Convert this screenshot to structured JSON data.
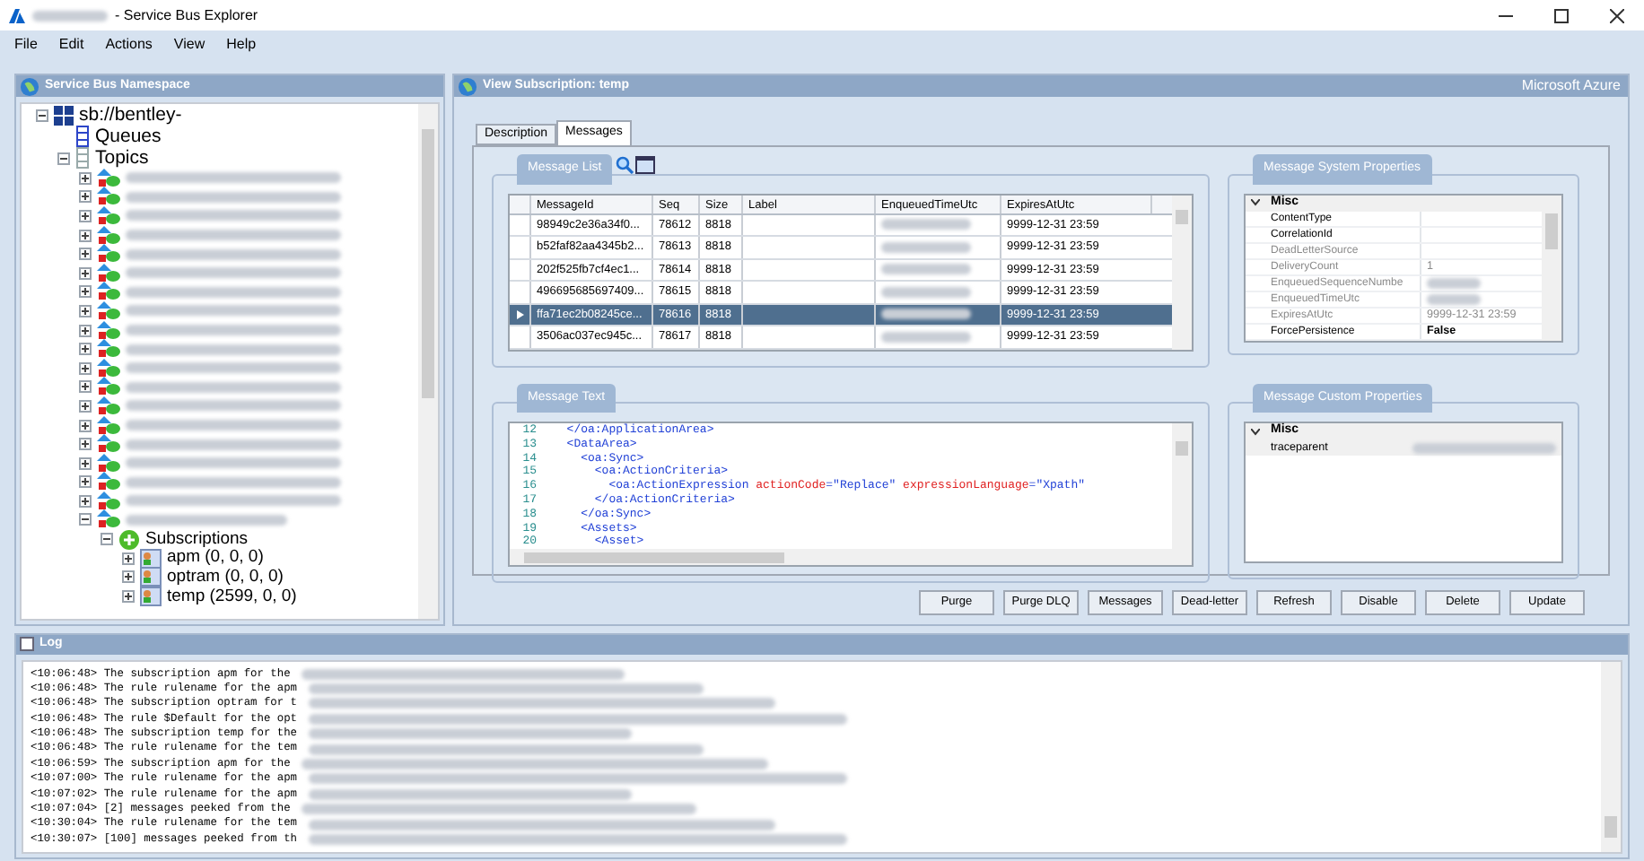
{
  "window": {
    "title": "- Service Bus Explorer",
    "brand": "Microsoft Azure"
  },
  "menu": [
    "File",
    "Edit",
    "Actions",
    "View",
    "Help"
  ],
  "namespace_panel": {
    "title": "Service Bus Namespace",
    "tree": {
      "label": "sb://bentley-",
      "expanded": true,
      "children": [
        {
          "label": "Queues",
          "kind": "queues"
        },
        {
          "label": "Topics",
          "kind": "topics",
          "expanded": true,
          "children": [
            {
              "kind": "topic",
              "expanded": false
            },
            {
              "kind": "topic",
              "expanded": false
            },
            {
              "kind": "topic",
              "expanded": false
            },
            {
              "kind": "topic",
              "expanded": false
            },
            {
              "kind": "topic",
              "expanded": false
            },
            {
              "kind": "topic",
              "expanded": false
            },
            {
              "kind": "topic",
              "expanded": false
            },
            {
              "kind": "topic",
              "expanded": false
            },
            {
              "kind": "topic",
              "expanded": false
            },
            {
              "kind": "topic",
              "expanded": false
            },
            {
              "kind": "topic",
              "expanded": false
            },
            {
              "kind": "topic",
              "expanded": false
            },
            {
              "kind": "topic",
              "expanded": false
            },
            {
              "kind": "topic",
              "expanded": false
            },
            {
              "kind": "topic",
              "expanded": false
            },
            {
              "kind": "topic",
              "expanded": false
            },
            {
              "kind": "topic",
              "expanded": false
            },
            {
              "kind": "topic",
              "expanded": false
            },
            {
              "kind": "topic",
              "expanded": true,
              "children": [
                {
                  "label": "Subscriptions",
                  "kind": "subscriptions",
                  "expanded": true,
                  "children": [
                    {
                      "label": "apm (0, 0, 0)",
                      "kind": "subscription",
                      "expanded": false
                    },
                    {
                      "label": "optram (0, 0, 0)",
                      "kind": "subscription",
                      "expanded": false
                    },
                    {
                      "label": "temp (2599, 0, 0)",
                      "kind": "subscription",
                      "expanded": false
                    }
                  ]
                }
              ]
            }
          ]
        }
      ]
    }
  },
  "view_panel": {
    "title": "View Subscription: temp",
    "tabs": [
      {
        "label": "Description",
        "selected": false
      },
      {
        "label": "Messages",
        "selected": true
      }
    ],
    "message_list": {
      "title": "Message List",
      "columns": [
        "MessageId",
        "Seq",
        "Size",
        "Label",
        "EnqueuedTimeUtc",
        "ExpiresAtUtc"
      ],
      "rows": [
        {
          "message_id": "98949c2e36a34f0...",
          "seq": "78612",
          "size": "8818",
          "expires": "9999-12-31 23:59",
          "selected": false
        },
        {
          "message_id": "b52faf82aa4345b2...",
          "seq": "78613",
          "size": "8818",
          "expires": "9999-12-31 23:59",
          "selected": false
        },
        {
          "message_id": "202f525fb7cf4ec1...",
          "seq": "78614",
          "size": "8818",
          "expires": "9999-12-31 23:59",
          "selected": false
        },
        {
          "message_id": "496695685697409...",
          "seq": "78615",
          "size": "8818",
          "expires": "9999-12-31 23:59",
          "selected": false
        },
        {
          "message_id": "ffa71ec2b08245ce...",
          "seq": "78616",
          "size": "8818",
          "expires": "9999-12-31 23:59",
          "selected": true
        },
        {
          "message_id": "3506ac037ec945c...",
          "seq": "78617",
          "size": "8818",
          "expires": "9999-12-31 23:59",
          "selected": false
        }
      ]
    },
    "system_properties": {
      "title": "Message System Properties",
      "category": "Misc",
      "rows": [
        {
          "name": "ContentType",
          "disabled": false
        },
        {
          "name": "CorrelationId",
          "disabled": false
        },
        {
          "name": "DeadLetterSource",
          "disabled": true
        },
        {
          "name": "DeliveryCount",
          "value": "1",
          "disabled": true
        },
        {
          "name": "EnqueuedSequenceNumbe",
          "disabled": true
        },
        {
          "name": "EnqueuedTimeUtc",
          "disabled": true
        },
        {
          "name": "ExpiresAtUtc",
          "value": "9999-12-31 23:59",
          "disabled": true
        },
        {
          "name": "ForcePersistence",
          "value": "False",
          "disabled": false,
          "modified": true
        }
      ]
    },
    "message_text": {
      "title": "Message Text",
      "lines": [
        {
          "number": "12",
          "tokens": [
            {
              "kind": "tag",
              "text": "  </oa:ApplicationArea>"
            }
          ]
        },
        {
          "number": "13",
          "tokens": [
            {
              "kind": "tag",
              "text": "  <DataArea>"
            }
          ]
        },
        {
          "number": "14",
          "tokens": [
            {
              "kind": "tag",
              "text": "    <oa:Sync>"
            }
          ]
        },
        {
          "number": "15",
          "tokens": [
            {
              "kind": "tag",
              "text": "      <oa:ActionCriteria>"
            }
          ]
        },
        {
          "number": "16",
          "tokens": [
            {
              "kind": "tag",
              "text": "        <oa:ActionExpression"
            },
            {
              "kind": "attr",
              "text": " actionCode"
            },
            {
              "kind": "tag",
              "text": "="
            },
            {
              "kind": "value",
              "text": "\"Replace\""
            },
            {
              "kind": "attr",
              "text": " expressionLanguage"
            },
            {
              "kind": "tag",
              "text": "="
            },
            {
              "kind": "value",
              "text": "\"Xpath\""
            }
          ]
        },
        {
          "number": "17",
          "tokens": [
            {
              "kind": "tag",
              "text": "      </oa:ActionCriteria>"
            }
          ]
        },
        {
          "number": "18",
          "tokens": [
            {
              "kind": "tag",
              "text": "    </oa:Sync>"
            }
          ]
        },
        {
          "number": "19",
          "tokens": [
            {
              "kind": "tag",
              "text": "    <Assets>"
            }
          ]
        },
        {
          "number": "20",
          "tokens": [
            {
              "kind": "tag",
              "text": "      <Asset>"
            }
          ]
        }
      ]
    },
    "custom_properties": {
      "title": "Message Custom Properties",
      "category": "Misc",
      "rows": [
        {
          "name": "traceparent"
        }
      ]
    },
    "buttons": [
      "Purge",
      "Purge DLQ",
      "Messages",
      "Dead-letter",
      "Refresh",
      "Disable",
      "Delete",
      "Update"
    ]
  },
  "log": {
    "title": "Log",
    "lines": [
      "<10:06:48> The subscription apm for the",
      "<10:06:48> The rule rulename for the apm",
      "<10:06:48> The subscription optram for t",
      "<10:06:48> The rule $Default for the opt",
      "<10:06:48> The subscription temp for the",
      "<10:06:48> The rule rulename for the tem",
      "<10:06:59> The subscription apm for the",
      "<10:07:00> The rule rulename for the apm",
      "<10:07:02> The rule rulename for the apm",
      "<10:07:04> [2] messages peeked from the",
      "<10:30:04> The rule rulename for the tem",
      "<10:30:07> [100] messages peeked from th"
    ]
  }
}
